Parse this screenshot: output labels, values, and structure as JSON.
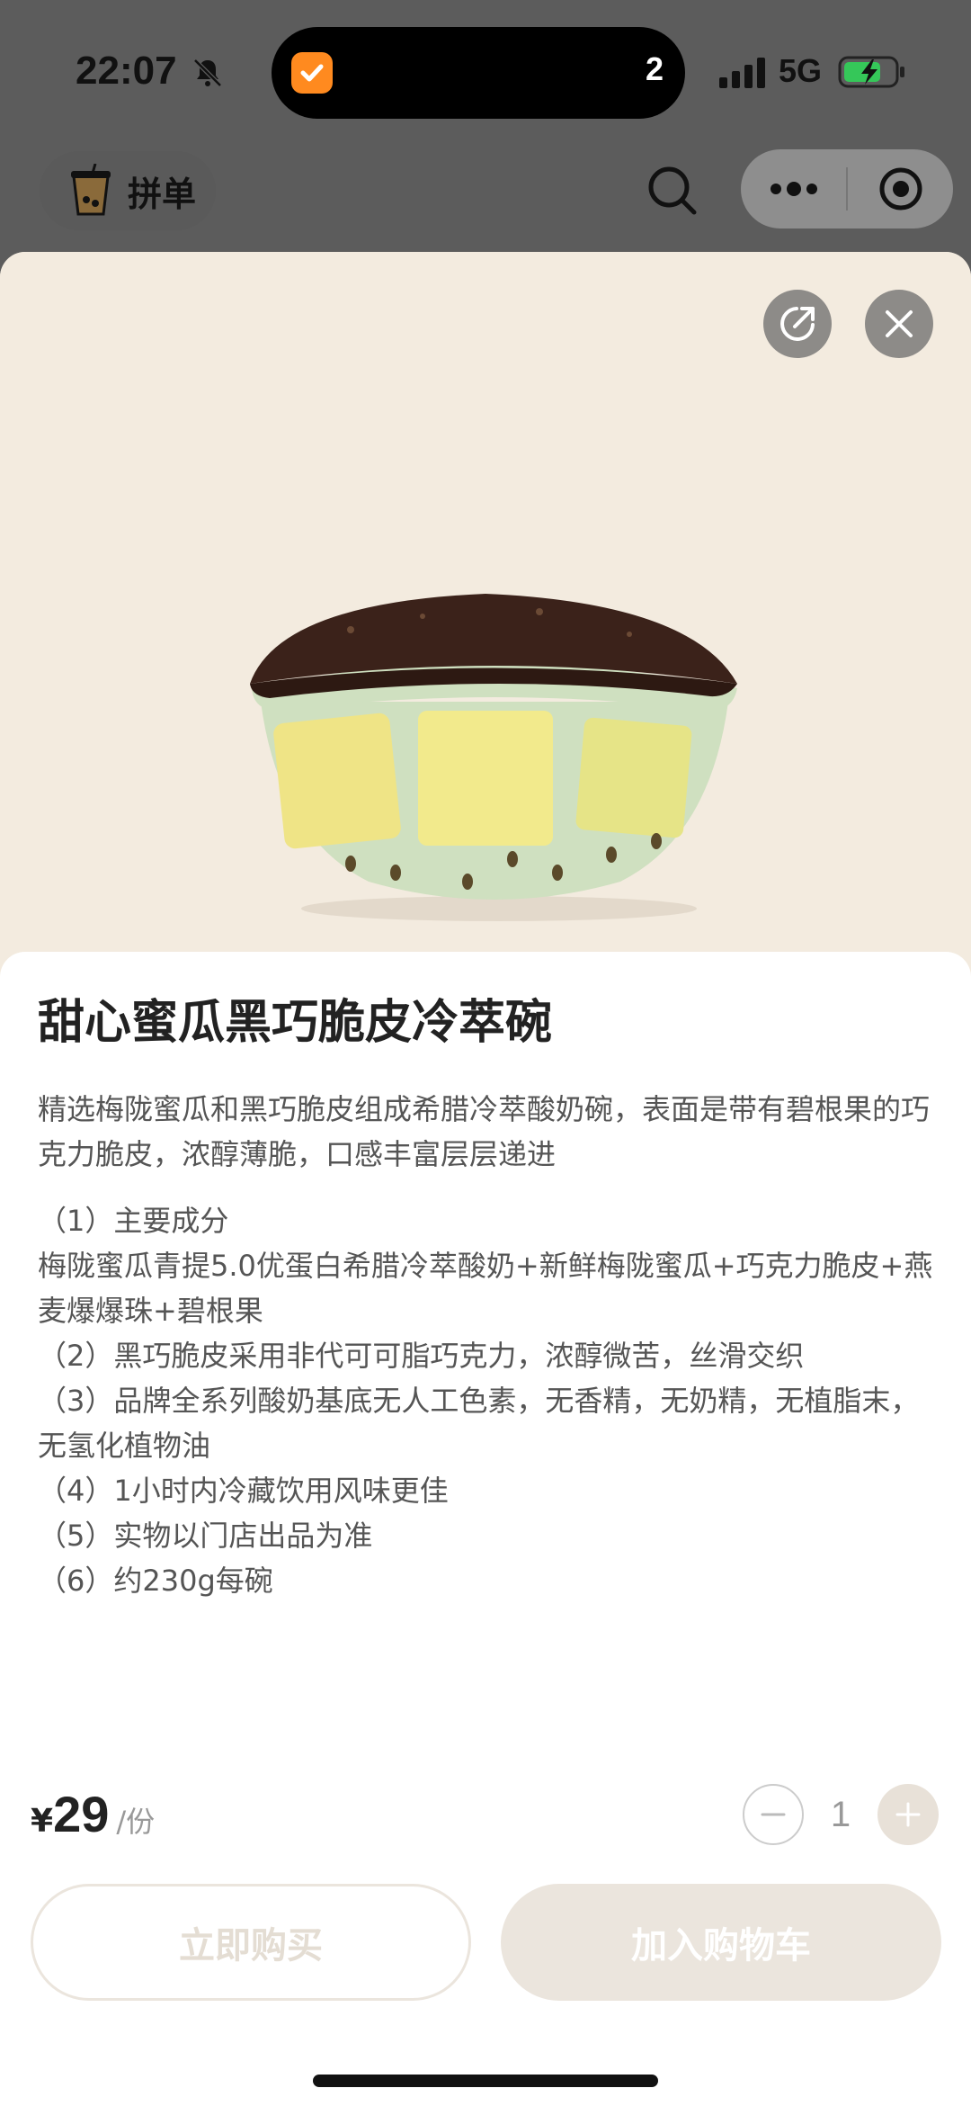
{
  "status_bar": {
    "time": "22:07",
    "island_count": "2",
    "network": "5G"
  },
  "mini_nav": {
    "group_order_label": "拼单"
  },
  "product": {
    "title": "甜心蜜瓜黑巧脆皮冷萃碗",
    "description": "精选梅陇蜜瓜和黑巧脆皮组成希腊冷萃酸奶碗，表面是带有碧根果的巧克力脆皮，浓醇薄脆，口感丰富层层递进",
    "details": [
      "（1）主要成分",
      "梅陇蜜瓜青提5.0优蛋白希腊冷萃酸奶+新鲜梅陇蜜瓜+巧克力脆皮+燕麦爆爆珠+碧根果",
      "（2）黑巧脆皮采用非代可可脂巧克力，浓醇微苦，丝滑交织",
      "（3）品牌全系列酸奶基底无人工色素，无香精，无奶精，无植脂末，无氢化植物油",
      "（4）1小时内冷藏饮用风味更佳",
      "（5）实物以门店出品为准",
      "（6）约230g每碗"
    ]
  },
  "footer": {
    "currency": "¥",
    "price": "29",
    "unit": "/份",
    "quantity": "1",
    "buy_now_label": "立即购买",
    "add_cart_label": "加入购物车"
  },
  "colors": {
    "hero_bg": "#f3ebdf",
    "island_app": "#ff8a1f",
    "button_beige": "#ebe5dd"
  }
}
